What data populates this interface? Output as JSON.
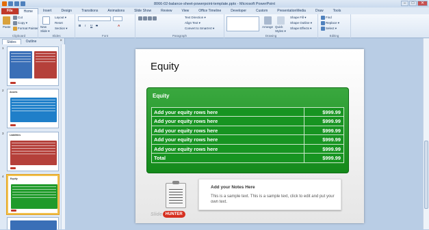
{
  "window": {
    "title": "8066-02-balance-sheet-powerpoint-template.pptx - Microsoft PowerPoint",
    "minimize": "–",
    "maximize": "□",
    "close": "✕"
  },
  "ribbon_tabs": [
    "File",
    "Home",
    "Insert",
    "Design",
    "Transitions",
    "Animations",
    "Slide Show",
    "Review",
    "View",
    "Office Timeline",
    "Developer",
    "Custom",
    "PresentationMedia",
    "Draw",
    "Tools"
  ],
  "ribbon": {
    "clipboard": {
      "label": "Clipboard",
      "paste": "Paste",
      "cut": "Cut",
      "copy": "Copy ▾",
      "format_painter": "Format Painter"
    },
    "slides": {
      "label": "Slides",
      "new_slide": "New Slide ▾",
      "layout": "Layout ▾",
      "reset": "Reset",
      "section": "Section ▾"
    },
    "font": {
      "label": "Font",
      "bold": "B",
      "italic": "I",
      "underline": "U",
      "strike": "S",
      "aa": "A"
    },
    "paragraph": {
      "label": "Paragraph",
      "text_direction": "Text Direction ▾",
      "align_text": "Align Text ▾",
      "convert_smartart": "Convert to SmartArt ▾"
    },
    "drawing": {
      "label": "Drawing",
      "arrange": "Arrange",
      "quick_styles": "Quick Styles ▾",
      "shape_fill": "Shape Fill ▾",
      "shape_outline": "Shape Outline ▾",
      "shape_effects": "Shape Effects ▾"
    },
    "editing": {
      "label": "Editing",
      "find": "Find",
      "replace": "Replace ▾",
      "select": "Select ▾"
    }
  },
  "panel": {
    "tab_slides": "Slides",
    "tab_outline": "Outline",
    "close": "×",
    "thumbnails": [
      {
        "num": "1",
        "title": "",
        "color": "#3a6fb7"
      },
      {
        "num": "2",
        "title": "Assets",
        "color": "#1f7fc9"
      },
      {
        "num": "3",
        "title": "Liabilities",
        "color": "#b5403a"
      },
      {
        "num": "4",
        "title": "Equity",
        "color": "#1f9a2a"
      }
    ]
  },
  "slide": {
    "title": "Equity",
    "table": {
      "header": "Equity",
      "rows": [
        {
          "label": "Add your equity rows here",
          "value": "$999.99"
        },
        {
          "label": "Add your equity rows here",
          "value": "$999.99"
        },
        {
          "label": "Add your equity rows here",
          "value": "$999.99"
        },
        {
          "label": "Add your equity rows here",
          "value": "$999.99"
        },
        {
          "label": "Add your equity rows here",
          "value": "$999.99"
        },
        {
          "label": "Total",
          "value": "$999.99"
        }
      ]
    },
    "notes_title": "Add your Notes Here",
    "notes_body": "This is a sample text. This is a sample text, click to edit and put your own text.",
    "logo_slide": "Slide",
    "logo_hunter": "HUNTER"
  },
  "colors": {
    "accent_green": "#179421",
    "file_tab": "#c0392b",
    "ribbon_bg": "#dfe9f5"
  }
}
